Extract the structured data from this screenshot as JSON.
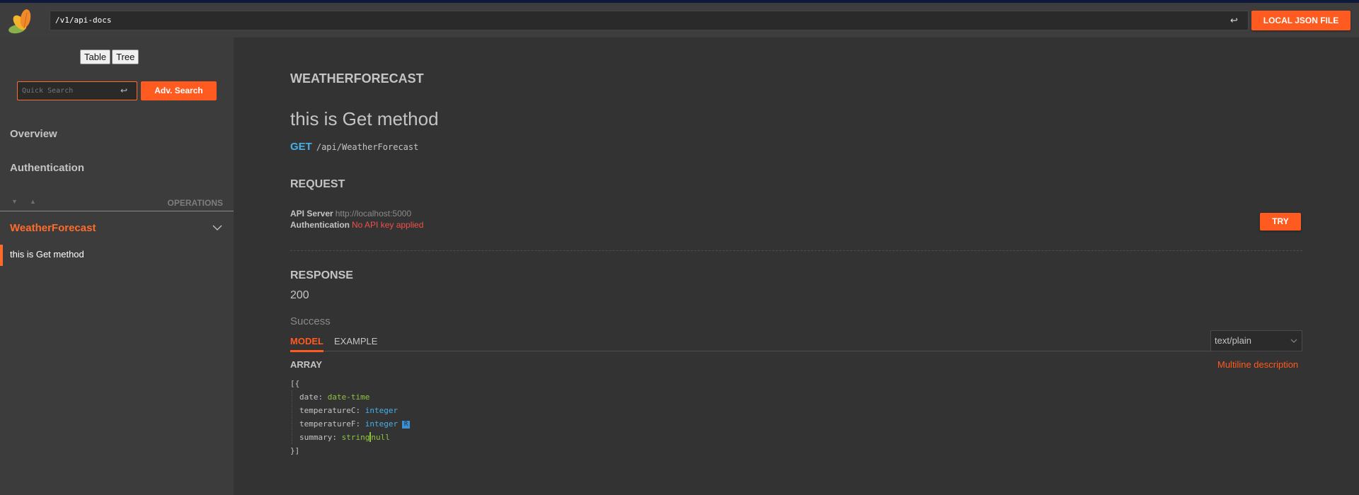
{
  "header": {
    "spec_url": "/v1/api-docs",
    "enter_icon": "↩",
    "local_json_label": "LOCAL JSON FILE"
  },
  "sidebar": {
    "view_toggle": [
      "Table",
      "Tree"
    ],
    "quick_search_placeholder": "Quick Search",
    "enter_icon": "↩",
    "adv_search_label": "Adv. Search",
    "nav": [
      "Overview",
      "Authentication"
    ],
    "ops_expand_icon": "▼",
    "ops_collapse_icon": "▲",
    "operations_label": "OPERATIONS",
    "tag": "WeatherForecast",
    "operation": "this is Get method"
  },
  "main": {
    "tag_heading": "WEATHERFORECAST",
    "op_title": "this is Get method",
    "method": "GET",
    "path": "/api/WeatherForecast",
    "request_heading": "REQUEST",
    "api_server_label": "API Server",
    "api_server_value": "http://localhost:5000",
    "auth_label": "Authentication",
    "auth_value": "No API key applied",
    "try_label": "TRY",
    "response_heading": "RESPONSE",
    "status_code": "200",
    "status_desc": "Success",
    "tabs": [
      "MODEL",
      "EXAMPLE"
    ],
    "active_tab": "MODEL",
    "mime_type": "text/plain",
    "array_label": "ARRAY",
    "multiline_label": "Multiline description",
    "model": {
      "open": "[{",
      "close": "}]",
      "fields": [
        {
          "name": "date:",
          "type": "date-time"
        },
        {
          "name": "temperatureC:",
          "type": "integer"
        },
        {
          "name": "temperatureF:",
          "type": "integer",
          "badge": "R"
        },
        {
          "name": "summary:",
          "type": "string",
          "extra": "null"
        }
      ]
    }
  },
  "colors": {
    "accent": "#ff5a1f",
    "method_get": "#47afe8",
    "error": "#f0504a",
    "type_green": "#8cc63f"
  }
}
